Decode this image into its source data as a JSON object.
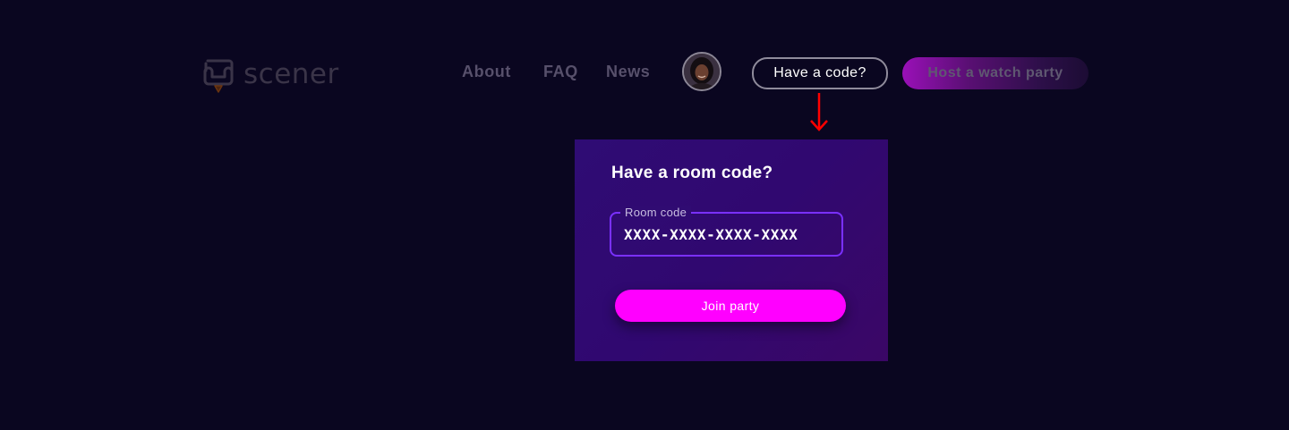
{
  "header": {
    "logo": {
      "text": "scener",
      "icon": "sofa-icon"
    },
    "nav": [
      {
        "label": "About"
      },
      {
        "label": "FAQ"
      },
      {
        "label": "News"
      }
    ],
    "avatar": {
      "icon": "user-avatar-photo"
    },
    "have_code_label": "Have a code?",
    "host_label": "Host a watch party"
  },
  "annotation": {
    "icon": "arrow-down-icon",
    "color": "#ff0000"
  },
  "popover": {
    "title": "Have a room code?",
    "room_code": {
      "label": "Room code",
      "placeholder": "XXXX-XXXX-XXXX-XXXX",
      "value": ""
    },
    "join_label": "Join party"
  },
  "colors": {
    "background": "#0a0620",
    "popover": "#300870",
    "field_border": "#7a30ff",
    "join_button": "#ff00ff",
    "host_button": "#9a10b8"
  }
}
